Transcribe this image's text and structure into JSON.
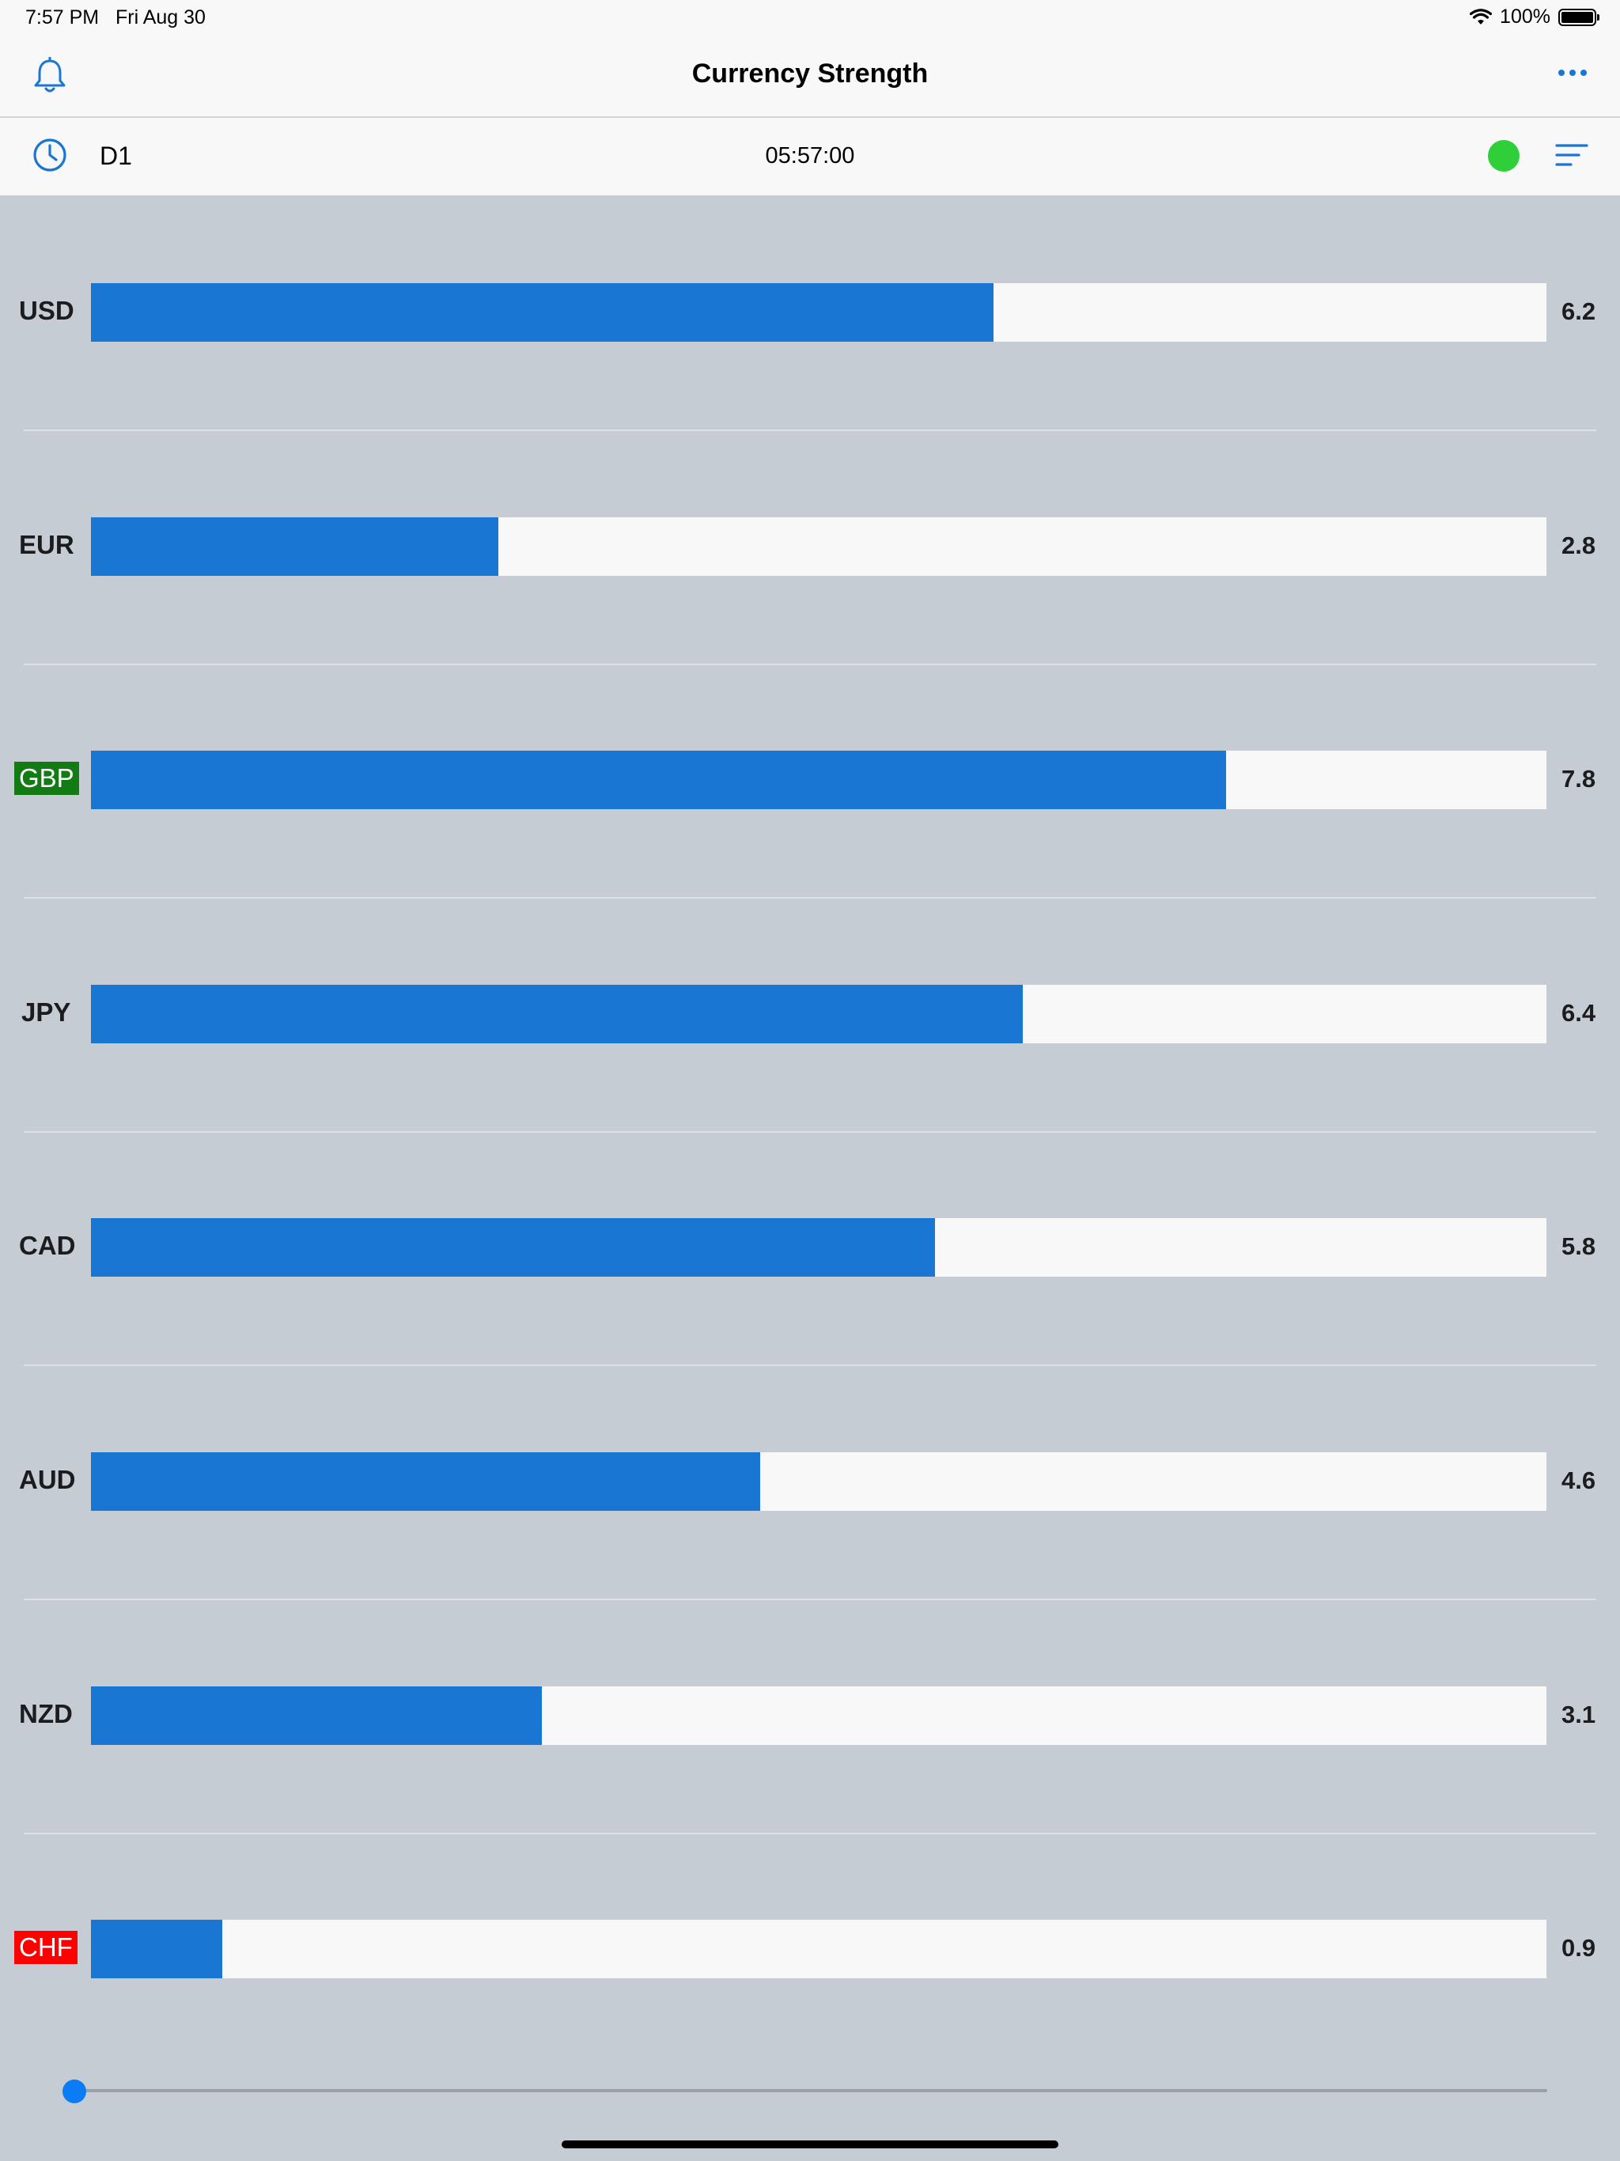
{
  "status_bar": {
    "time": "7:57 PM",
    "date": "Fri Aug 30",
    "battery_text": "100%",
    "icons": [
      "wifi-icon",
      "battery-icon"
    ]
  },
  "nav": {
    "title": "Currency Strength",
    "left_icon": "bell-icon",
    "right_icon": "more-icon"
  },
  "toolbar": {
    "timeframe": "D1",
    "countdown": "05:57:00",
    "left_icon": "clock-icon",
    "right_icon": "sort-icon",
    "status_dot_color": "#2fcf3a"
  },
  "colors": {
    "bar": "#1a76d3",
    "strongest_highlight": "#127b14",
    "weakest_highlight": "#ff0000"
  },
  "chart_data": {
    "type": "bar",
    "orientation": "horizontal",
    "xlim": [
      0,
      10
    ],
    "categories": [
      "USD",
      "EUR",
      "GBP",
      "JPY",
      "CAD",
      "AUD",
      "NZD",
      "CHF"
    ],
    "values": [
      6.2,
      2.8,
      7.8,
      6.4,
      5.8,
      4.6,
      3.1,
      0.9
    ],
    "value_labels": [
      "6.2",
      "2.8",
      "7.8",
      "6.4",
      "5.8",
      "4.6",
      "3.1",
      "0.9"
    ],
    "highlights": {
      "GBP": "strongest",
      "CHF": "weakest"
    }
  },
  "slider": {
    "position_fraction": 0.0
  }
}
